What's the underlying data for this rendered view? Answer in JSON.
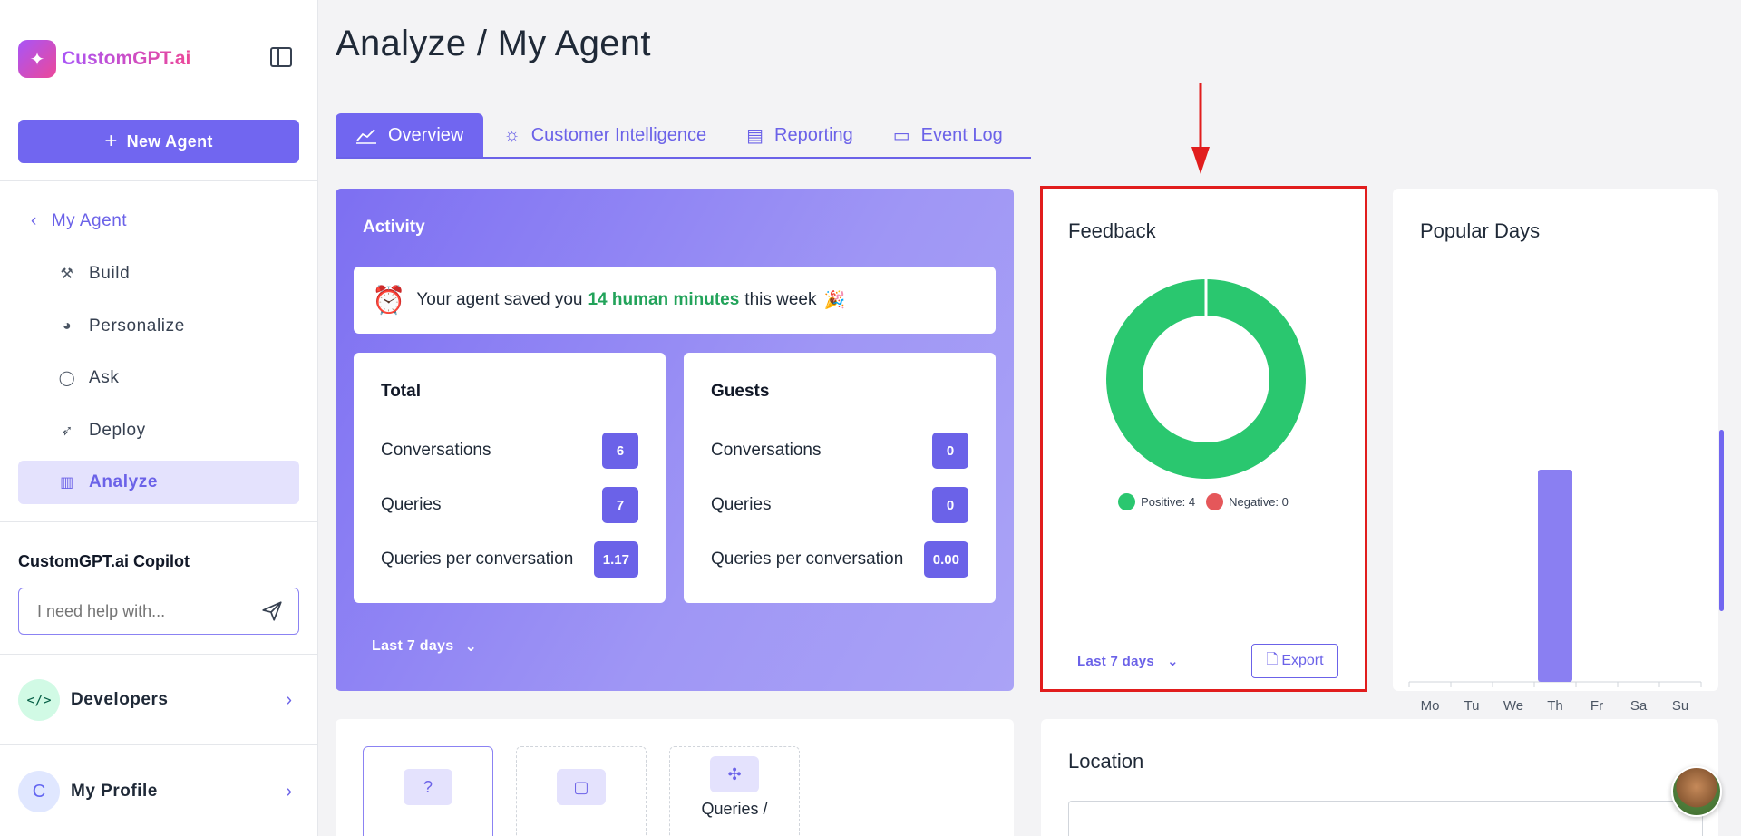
{
  "brand": {
    "logo_text": "CustomGPT.ai",
    "accent": "#7166f0",
    "positive": "#2ac76f",
    "negative": "#e5575a"
  },
  "sidebar": {
    "new_agent_label": "New Agent",
    "back_label": "My Agent",
    "items": [
      {
        "label": "Build",
        "icon": "build-icon"
      },
      {
        "label": "Personalize",
        "icon": "palette-icon"
      },
      {
        "label": "Ask",
        "icon": "chat-icon"
      },
      {
        "label": "Deploy",
        "icon": "rocket-icon"
      },
      {
        "label": "Analyze",
        "icon": "bar-chart-icon",
        "active": true
      }
    ],
    "copilot": {
      "title": "CustomGPT.ai Copilot",
      "placeholder": "I need help with..."
    },
    "developers_label": "Developers",
    "profile": {
      "label": "My Profile",
      "initial": "C"
    }
  },
  "page": {
    "title": "Analyze / My Agent"
  },
  "tabs": [
    {
      "label": "Overview",
      "active": true
    },
    {
      "label": "Customer Intelligence"
    },
    {
      "label": "Reporting"
    },
    {
      "label": "Event Log"
    }
  ],
  "activity": {
    "title": "Activity",
    "saved_prefix": "Your agent saved you",
    "saved_highlight": "14 human minutes",
    "saved_suffix": "this week",
    "total": {
      "title": "Total",
      "rows": [
        {
          "label": "Conversations",
          "value": "6"
        },
        {
          "label": "Queries",
          "value": "7"
        },
        {
          "label": "Queries per conversation",
          "value": "1.17"
        }
      ]
    },
    "guests": {
      "title": "Guests",
      "rows": [
        {
          "label": "Conversations",
          "value": "0"
        },
        {
          "label": "Queries",
          "value": "0"
        },
        {
          "label": "Queries per conversation",
          "value": "0.00"
        }
      ]
    },
    "range_label": "Last 7 days"
  },
  "feedback": {
    "title": "Feedback",
    "positive_label": "Positive: 4",
    "negative_label": "Negative: 0",
    "range_label": "Last 7 days",
    "export_label": "Export"
  },
  "popular_days": {
    "title": "Popular Days"
  },
  "chart_data": {
    "type": "bar",
    "title": "Popular Days",
    "categories": [
      "Mo",
      "Tu",
      "We",
      "Th",
      "Fr",
      "Sa",
      "Su"
    ],
    "values": [
      0,
      0,
      0,
      1,
      0,
      0,
      0
    ]
  },
  "bottom": {
    "tiles": [
      {
        "icon": "question-icon",
        "label": ""
      },
      {
        "icon": "message-icon",
        "label": ""
      },
      {
        "icon": "cursor-click-icon",
        "label": "Queries /"
      }
    ],
    "location_title": "Location"
  }
}
